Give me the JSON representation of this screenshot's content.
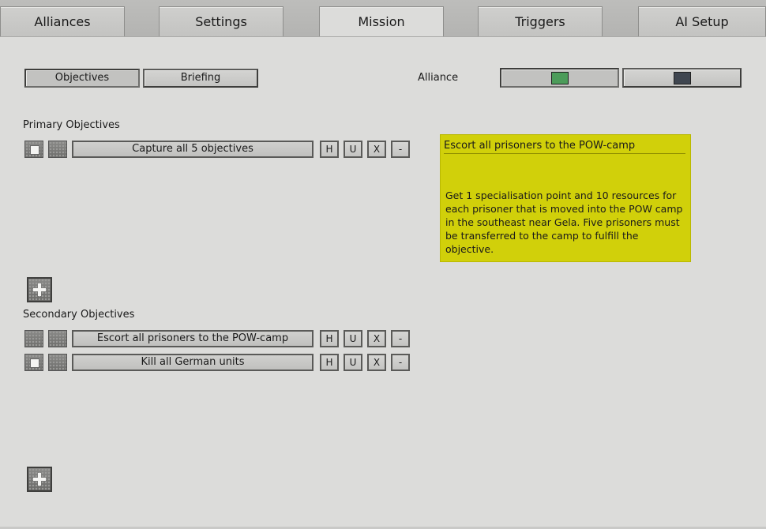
{
  "tabs": [
    "Alliances",
    "Settings",
    "Mission",
    "Triggers",
    "AI Setup"
  ],
  "subtabs": [
    "Objectives",
    "Briefing"
  ],
  "alliance_label": "Alliance",
  "alliance_colors": [
    "#4c9c5a",
    "#3f4650"
  ],
  "primary_label": "Primary Objectives",
  "secondary_label": "Secondary Objectives",
  "primary_objectives": [
    {
      "name": "Capture all 5 objectives",
      "buttons": [
        "H",
        "U",
        "X",
        "-"
      ]
    }
  ],
  "secondary_objectives": [
    {
      "name": "Escort all prisoners to the POW-camp",
      "buttons": [
        "H",
        "U",
        "X",
        "-"
      ]
    },
    {
      "name": "Kill all German units",
      "buttons": [
        "H",
        "U",
        "X",
        "-"
      ]
    }
  ],
  "note": {
    "title": "Escort all prisoners to the POW-camp",
    "body": "Get 1 specialisation point and 10 resources for each prisoner that is moved into the POW camp in the southeast near Gela.  Five prisoners must be transferred to the camp to fulfill the objective."
  },
  "icons": [
    "add-icon",
    "checkbox-icon",
    "texture-icon"
  ],
  "accent_note_color": "#d1d00a"
}
